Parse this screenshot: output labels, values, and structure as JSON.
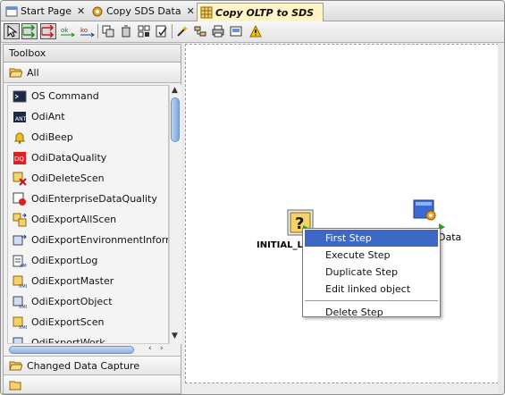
{
  "tabs": [
    {
      "label": "Start Page",
      "close": "✕",
      "icon": "start-page-icon",
      "active": false
    },
    {
      "label": "Copy SDS Data",
      "close": "✕",
      "icon": "package-gear-icon",
      "active": false
    },
    {
      "label": "Copy OLTP to SDS",
      "close": "",
      "icon": "grid-package-icon",
      "active": true
    }
  ],
  "toolbar": {
    "icons": [
      "select-pointer-icon",
      "next-step-ok-icon",
      "next-step-ko-icon",
      "ok-link-icon",
      "ko-link-icon",
      "duplicate-icon",
      "delete-icon",
      "arrange-icon",
      "validate-icon",
      "wand-icon",
      "rearrange-icon",
      "print-icon",
      "save-image-icon",
      "warning-icon"
    ]
  },
  "toolbox": {
    "title": "Toolbox",
    "section_all": "All",
    "items": [
      {
        "label": "OS Command",
        "icon": "terminal-icon"
      },
      {
        "label": "OdiAnt",
        "icon": "ant-icon"
      },
      {
        "label": "OdiBeep",
        "icon": "bell-icon"
      },
      {
        "label": "OdiDataQuality",
        "icon": "data-quality-icon"
      },
      {
        "label": "OdiDeleteScen",
        "icon": "delete-scenario-icon"
      },
      {
        "label": "OdiEnterpriseDataQuality",
        "icon": "enterprise-dq-icon"
      },
      {
        "label": "OdiExportAllScen",
        "icon": "export-all-scen-icon"
      },
      {
        "label": "OdiExportEnvironmentInform",
        "icon": "export-env-icon"
      },
      {
        "label": "OdiExportLog",
        "icon": "export-log-icon"
      },
      {
        "label": "OdiExportMaster",
        "icon": "export-master-icon"
      },
      {
        "label": "OdiExportObject",
        "icon": "export-object-icon"
      },
      {
        "label": "OdiExportScen",
        "icon": "export-scen-icon"
      },
      {
        "label": "OdiExportWork",
        "icon": "export-work-icon"
      }
    ],
    "section_changed": "Changed Data Capture"
  },
  "canvas": {
    "steps": [
      {
        "label": "INITIAL_L",
        "icon": "unknown-step-icon"
      },
      {
        "label": "Data",
        "icon": "interface-step-icon"
      }
    ]
  },
  "context_menu": {
    "items": [
      "First Step",
      "Execute Step",
      "Duplicate Step",
      "Edit linked object",
      "Delete Step"
    ],
    "highlighted": "First Step"
  },
  "colors": {
    "active_tab": "#fff4c6",
    "menu_highlight": "#3d68c6",
    "scrollbar_thumb": "#8db1e1"
  }
}
